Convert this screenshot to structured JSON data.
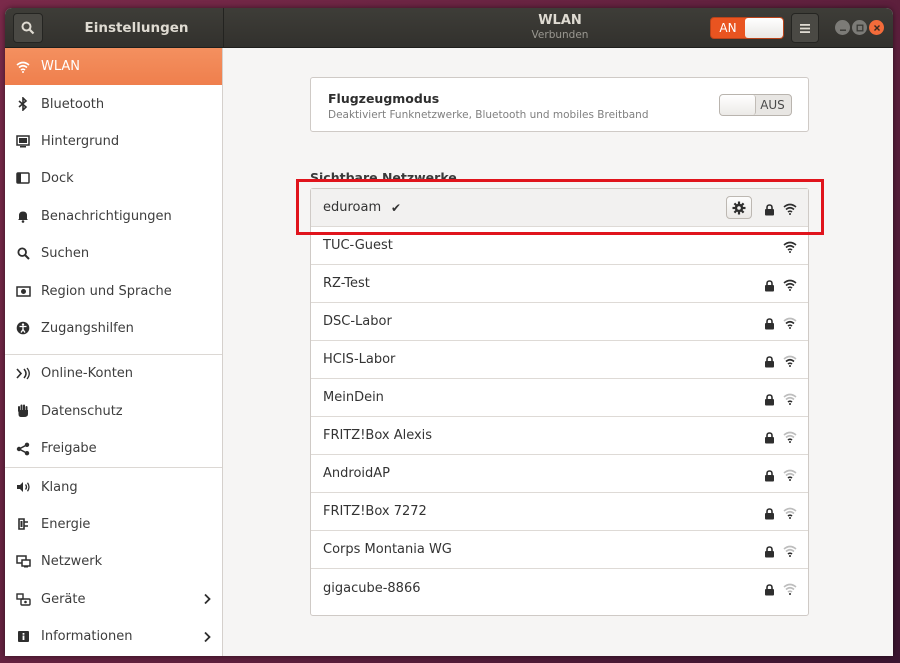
{
  "titlebar": {
    "app_title": "Einstellungen",
    "page_title": "WLAN",
    "page_subtitle": "Verbunden",
    "wifi_switch_label": "AN"
  },
  "sidebar": {
    "items": [
      {
        "label": "WLAN",
        "icon": "wifi-icon",
        "active": true
      },
      {
        "label": "Bluetooth",
        "icon": "bluetooth-icon"
      },
      {
        "label": "Hintergrund",
        "icon": "background-icon"
      },
      {
        "label": "Dock",
        "icon": "dock-icon"
      },
      {
        "label": "Benachrichtigungen",
        "icon": "bell-icon"
      },
      {
        "label": "Suchen",
        "icon": "search-icon"
      },
      {
        "label": "Region und Sprache",
        "icon": "region-icon"
      },
      {
        "label": "Zugangshilfen",
        "icon": "accessibility-icon"
      },
      {
        "label": "Online-Konten",
        "icon": "online-accounts-icon"
      },
      {
        "label": "Datenschutz",
        "icon": "hand-icon"
      },
      {
        "label": "Freigabe",
        "icon": "share-icon"
      },
      {
        "label": "Klang",
        "icon": "speaker-icon"
      },
      {
        "label": "Energie",
        "icon": "power-icon"
      },
      {
        "label": "Netzwerk",
        "icon": "network-icon"
      },
      {
        "label": "Geräte",
        "icon": "devices-icon",
        "chevron": true
      },
      {
        "label": "Informationen",
        "icon": "info-icon",
        "chevron": true
      }
    ]
  },
  "airplane": {
    "title": "Flugzeugmodus",
    "description": "Deaktiviert Funknetzwerke, Bluetooth und mobiles Breitband",
    "switch_label": "AUS"
  },
  "networks": {
    "heading": "Sichtbare Netzwerke",
    "items": [
      {
        "name": "eduroam",
        "connected": true,
        "locked": true,
        "signal": "strong"
      },
      {
        "name": "TUC-Guest",
        "locked": false,
        "signal": "strong"
      },
      {
        "name": "RZ-Test",
        "locked": true,
        "signal": "strong"
      },
      {
        "name": "DSC-Labor",
        "locked": true,
        "signal": "good"
      },
      {
        "name": "HCIS-Labor",
        "locked": true,
        "signal": "good"
      },
      {
        "name": "MeinDein",
        "locked": true,
        "signal": "weak"
      },
      {
        "name": "FRITZ!Box Alexis",
        "locked": true,
        "signal": "weak"
      },
      {
        "name": "AndroidAP",
        "locked": true,
        "signal": "weak"
      },
      {
        "name": "FRITZ!Box 7272",
        "locked": true,
        "signal": "weak"
      },
      {
        "name": "Corps Montania WG",
        "locked": true,
        "signal": "weak"
      },
      {
        "name": "gigacube-8866",
        "locked": true,
        "signal": "weak"
      }
    ]
  },
  "colors": {
    "accent": "#e95420",
    "highlight": "#e0141c"
  }
}
